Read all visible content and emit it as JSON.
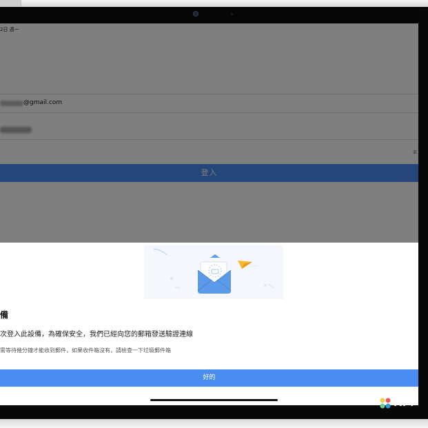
{
  "status_bar": {
    "date": "2日 週一"
  },
  "login_form": {
    "email_suffix": "@gmail.com",
    "login_label": "登入",
    "password_toggle": "ꕤ"
  },
  "verify_sheet": {
    "title": "備",
    "description": "次登入此設備，為確保安全，我們已經向您的郵箱發送驗證連線",
    "note": "需等待幾分鐘才能收到郵件，如果收件箱沒有，請檢查一下垃圾郵件箱",
    "ok_label": "好的"
  },
  "watermark": {
    "text": "APP"
  },
  "colors": {
    "primary": "#4a8df0",
    "overlay": "#000000",
    "envelope": "#5b9ae8",
    "paper_plane": "#f7b733"
  },
  "icons": {
    "illustration": "envelope-icon",
    "plane": "paper-plane-icon",
    "watermark": "logo-icon"
  }
}
